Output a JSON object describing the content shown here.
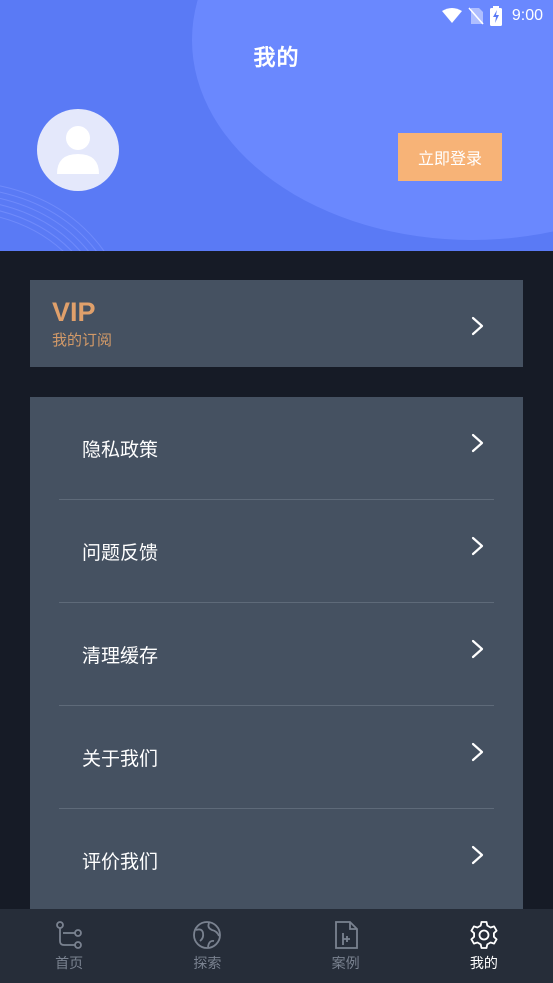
{
  "status_bar": {
    "time": "9:00"
  },
  "header": {
    "title": "我的",
    "login_label": "立即登录"
  },
  "vip": {
    "title": "VIP",
    "subtitle": "我的订阅"
  },
  "menu": {
    "items": [
      {
        "label": "隐私政策"
      },
      {
        "label": "问题反馈"
      },
      {
        "label": "清理缓存"
      },
      {
        "label": "关于我们"
      },
      {
        "label": "评价我们"
      }
    ]
  },
  "bottom_nav": {
    "items": [
      {
        "label": "首页",
        "icon": "route-icon"
      },
      {
        "label": "探索",
        "icon": "globe-icon"
      },
      {
        "label": "案例",
        "icon": "document-icon"
      },
      {
        "label": "我的",
        "icon": "gear-icon"
      }
    ],
    "active": "我的"
  },
  "colors": {
    "header_bg": "#5a7af5",
    "accent_orange": "#f7b377",
    "vip_gold": "#e0a06b",
    "card_bg": "#455161",
    "page_bg": "#161b26",
    "nav_bg": "#262d39"
  }
}
